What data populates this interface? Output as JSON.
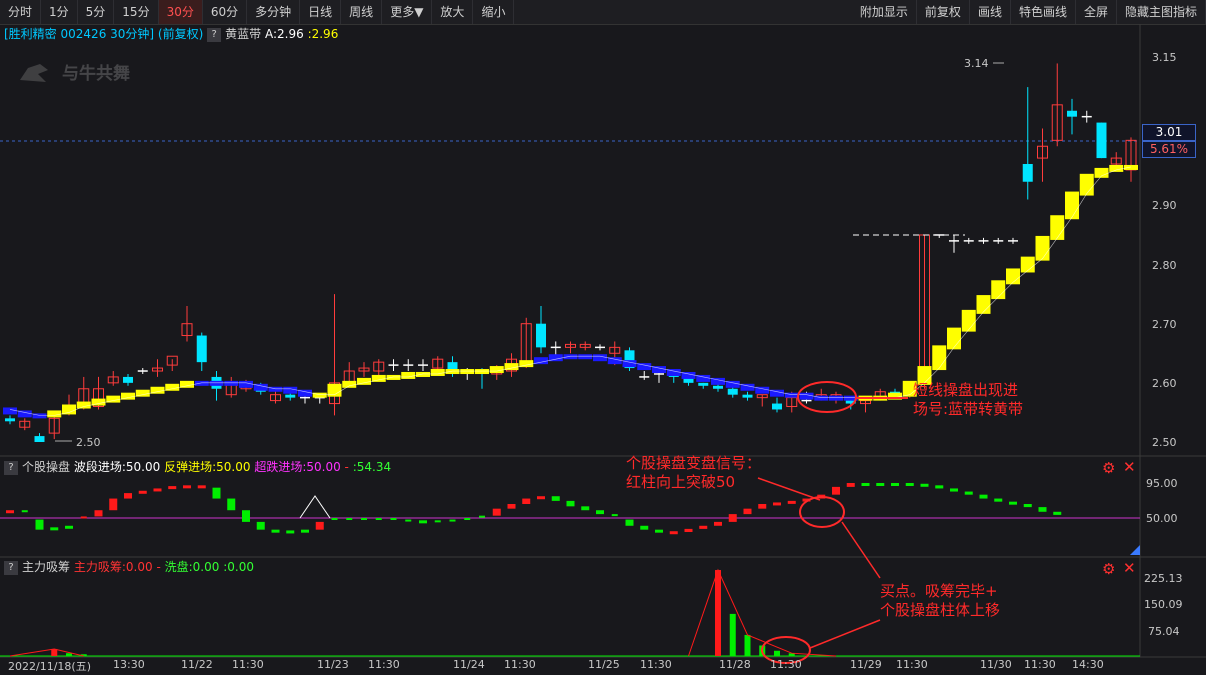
{
  "toolbar": {
    "tabs": [
      "分时",
      "1分",
      "5分",
      "15分",
      "30分",
      "60分",
      "多分钟",
      "日线",
      "周线",
      "更多▼",
      "放大",
      "缩小"
    ],
    "active": "30分",
    "right": [
      "附加显示",
      "前复权",
      "画线",
      "特色画线",
      "全屏",
      "隐藏主图指标"
    ]
  },
  "main": {
    "stock_name": "[胜利精密",
    "code_period": "002426 30分钟]",
    "adjust": "(前复权)",
    "indicator_name": "黄蓝带",
    "a_value": "A:2.96",
    "b_value": ":2.96",
    "watermark": "与牛共舞",
    "high_label": "3.14",
    "low_label": "2.50",
    "price_tag": "3.01",
    "pct_tag": "5.61%",
    "y_ticks": [
      "3.15",
      "2.90",
      "2.80",
      "2.70",
      "2.60",
      "2.50"
    ]
  },
  "panel1": {
    "name": "个股操盘",
    "f1": "波段进场:50.00",
    "f2": "反弹进场:50.00",
    "f3": "超跌进场:50.00",
    "f4": "-",
    "f5": ":54.34",
    "y_ticks": [
      "95.00",
      "50.00"
    ]
  },
  "panel2": {
    "name": "主力吸筹",
    "f1": "主力吸筹:0.00",
    "f2": "-",
    "f3": "洗盘:0.00",
    "f4": ":0.00",
    "y_ticks": [
      "225.13",
      "150.09",
      "75.04"
    ]
  },
  "x_labels": [
    "2022/11/18(五)",
    "13:30",
    "11/22",
    "11:30",
    "11/23",
    "11:30",
    "11/24",
    "11:30",
    "11/25",
    "11:30",
    "11/28",
    "11:30",
    "11/29",
    "11:30",
    "11/30",
    "11:30",
    "14:30"
  ],
  "annotations": {
    "a1_line1": "短线操盘出现进",
    "a1_line2": "场号:蓝带转黄带",
    "a2_line1": "个股操盘变盘信号：",
    "a2_line2": "红柱向上突破50",
    "a3_line1": "买点。吸筹完毕+",
    "a3_line2": "个股操盘柱体上移"
  },
  "colors": {
    "up": "#ff3c3c",
    "down": "#00e5ff",
    "band_yellow": "#ffff00",
    "band_blue": "#1a1aff",
    "signal_red": "#ff1a1a",
    "signal_green": "#00ee00",
    "midline": "#cc33cc",
    "annotation": "#ff2a2a"
  },
  "icons": [
    "gear-icon",
    "close-icon"
  ]
}
